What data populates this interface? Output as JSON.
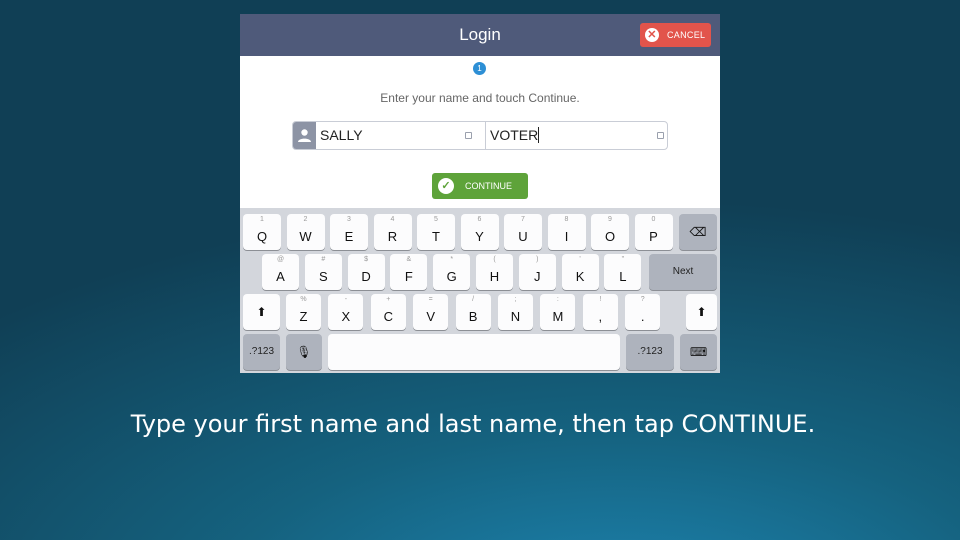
{
  "header": {
    "title": "Login",
    "cancel_label": "CANCEL"
  },
  "step_number": "1",
  "instruction": "Enter your name and touch Continue.",
  "form": {
    "first_name": "SALLY",
    "last_name": "VOTER"
  },
  "continue_label": "CONTINUE",
  "keyboard": {
    "row1": [
      {
        "hint": "1",
        "key": "Q"
      },
      {
        "hint": "2",
        "key": "W"
      },
      {
        "hint": "3",
        "key": "E"
      },
      {
        "hint": "4",
        "key": "R"
      },
      {
        "hint": "5",
        "key": "T"
      },
      {
        "hint": "6",
        "key": "Y"
      },
      {
        "hint": "7",
        "key": "U"
      },
      {
        "hint": "8",
        "key": "I"
      },
      {
        "hint": "9",
        "key": "O"
      },
      {
        "hint": "0",
        "key": "P"
      }
    ],
    "row2": [
      {
        "hint": "@",
        "key": "A"
      },
      {
        "hint": "#",
        "key": "S"
      },
      {
        "hint": "$",
        "key": "D"
      },
      {
        "hint": "&",
        "key": "F"
      },
      {
        "hint": "*",
        "key": "G"
      },
      {
        "hint": "(",
        "key": "H"
      },
      {
        "hint": ")",
        "key": "J"
      },
      {
        "hint": "'",
        "key": "K"
      },
      {
        "hint": "\"",
        "key": "L"
      }
    ],
    "row3": [
      {
        "hint": "%",
        "key": "Z"
      },
      {
        "hint": "-",
        "key": "X"
      },
      {
        "hint": "+",
        "key": "C"
      },
      {
        "hint": "=",
        "key": "V"
      },
      {
        "hint": "/",
        "key": "B"
      },
      {
        "hint": ";",
        "key": "N"
      },
      {
        "hint": ":",
        "key": "M"
      },
      {
        "hint": "!",
        "key": ","
      },
      {
        "hint": "?",
        "key": "."
      }
    ],
    "next_label": "Next",
    "numbers_label": ".?123"
  },
  "caption": "Type your first name and last name, then tap CONTINUE.",
  "colors": {
    "header": "#4f5a7a",
    "cancel": "#e2544b",
    "continue": "#5ea33a",
    "step_badge": "#2d8fd5",
    "background": "#15627f"
  }
}
